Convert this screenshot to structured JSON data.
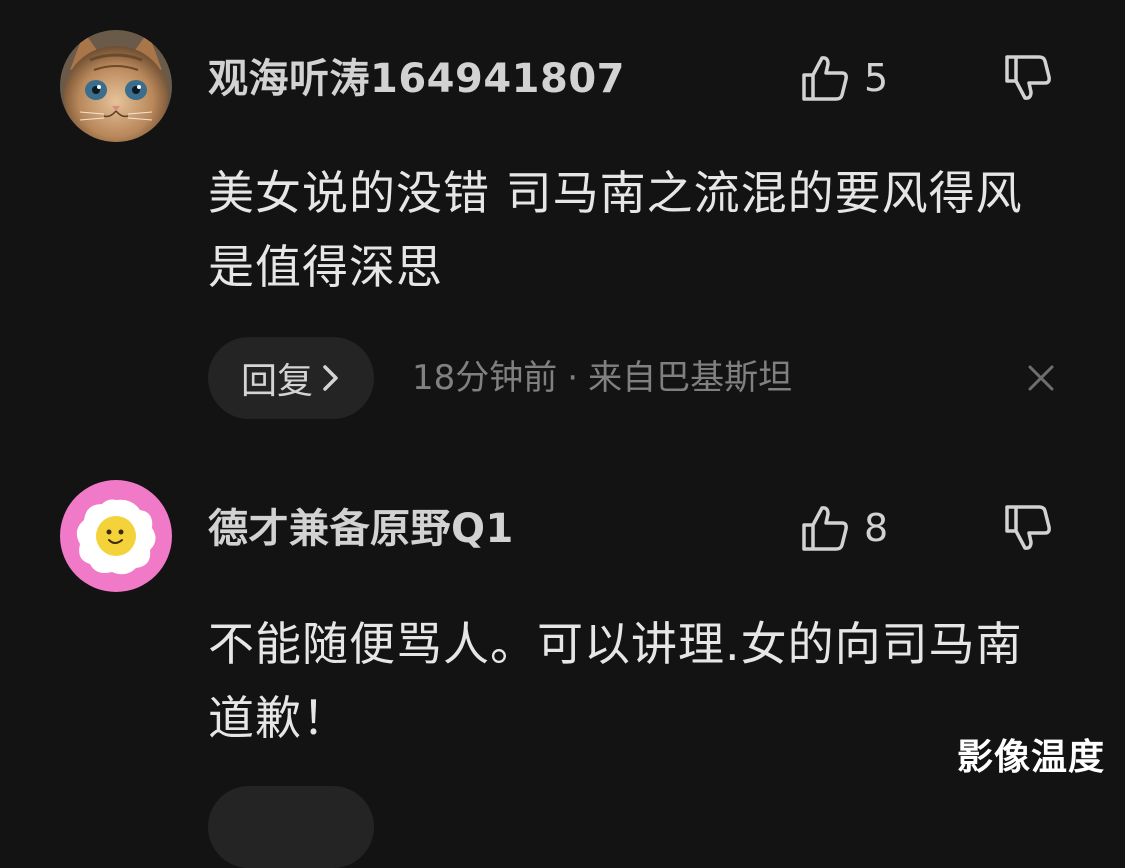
{
  "comments": [
    {
      "username": "观海听涛164941807",
      "likes": "5",
      "text": "美女说的没错 司马南之流混的要风得风是值得深思",
      "reply_label": "回复",
      "time": "18分钟前",
      "separator": "·",
      "location": "来自巴基斯坦",
      "avatar_icon": "kitten-avatar-icon"
    },
    {
      "username": "德才兼备原野Q1",
      "likes": "8",
      "text": "不能随便骂人。可以讲理.女的向司马南道歉！",
      "avatar_icon": "fried-egg-avatar-icon"
    }
  ],
  "watermark": "影像温度",
  "colors": {
    "background": "#131313",
    "text_primary": "#e6e6e6",
    "text_secondary": "#808080",
    "pill": "#242424",
    "avatar_pink": "#f079c8"
  }
}
